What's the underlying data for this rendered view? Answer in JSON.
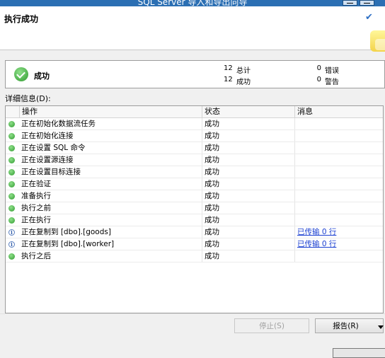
{
  "window": {
    "title": "SQL Server 导入和导出向导"
  },
  "header": {
    "heading": "执行成功"
  },
  "summary": {
    "status": "成功",
    "total_count": "12",
    "total_label": "总计",
    "success_count": "12",
    "success_label": "成功",
    "error_count": "0",
    "error_label": "错误",
    "warning_count": "0",
    "warning_label": "警告"
  },
  "details_label": "详细信息(D):",
  "grid": {
    "columns": [
      "操作",
      "状态",
      "消息"
    ],
    "rows": [
      {
        "icon": "success-icon",
        "action": "正在初始化数据流任务",
        "status": "成功",
        "message": ""
      },
      {
        "icon": "success-icon",
        "action": "正在初始化连接",
        "status": "成功",
        "message": ""
      },
      {
        "icon": "success-icon",
        "action": "正在设置 SQL 命令",
        "status": "成功",
        "message": ""
      },
      {
        "icon": "success-icon",
        "action": "正在设置源连接",
        "status": "成功",
        "message": ""
      },
      {
        "icon": "success-icon",
        "action": "正在设置目标连接",
        "status": "成功",
        "message": ""
      },
      {
        "icon": "success-icon",
        "action": "正在验证",
        "status": "成功",
        "message": ""
      },
      {
        "icon": "success-icon",
        "action": "准备执行",
        "status": "成功",
        "message": ""
      },
      {
        "icon": "success-icon",
        "action": "执行之前",
        "status": "成功",
        "message": ""
      },
      {
        "icon": "success-icon",
        "action": "正在执行",
        "status": "成功",
        "message": ""
      },
      {
        "icon": "info-icon",
        "action": "正在复制到 [dbo].[goods]",
        "status": "成功",
        "message": "已传输 0 行"
      },
      {
        "icon": "info-icon",
        "action": "正在复制到 [dbo].[worker]",
        "status": "成功",
        "message": "已传输 0 行"
      },
      {
        "icon": "success-icon",
        "action": "执行之后",
        "status": "成功",
        "message": ""
      }
    ]
  },
  "buttons": {
    "stop": "停止(S)",
    "report": "报告(R)"
  }
}
